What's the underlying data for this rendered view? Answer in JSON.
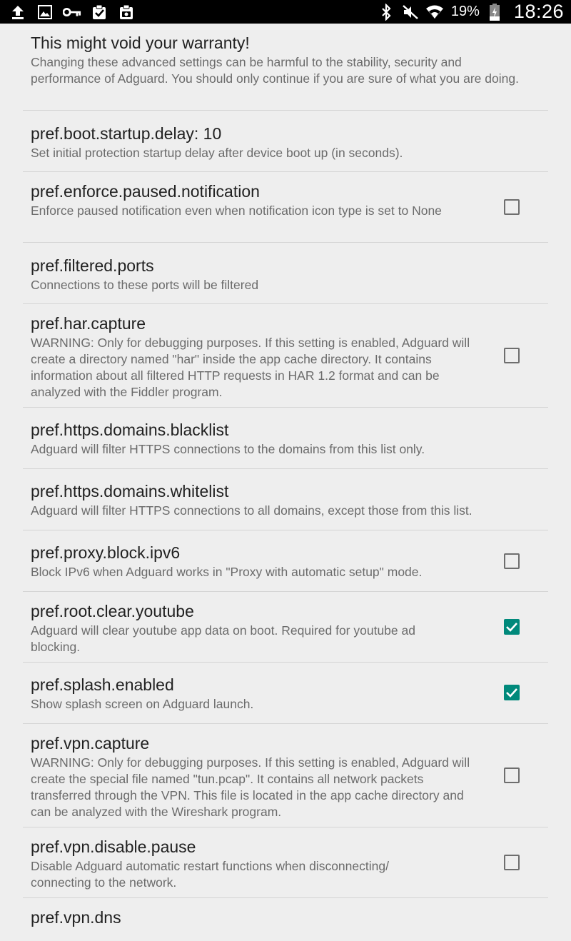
{
  "status_bar": {
    "left_icons": [
      "upload-icon",
      "image-icon",
      "key-icon",
      "clipboard-check-icon",
      "clipboard-camera-icon"
    ],
    "right_icons": [
      "bluetooth-icon",
      "muted-icon",
      "wifi-icon",
      "battery-charging-icon"
    ],
    "battery": "19%",
    "time": "18:26"
  },
  "preferences": [
    {
      "title": "This might void your warranty!",
      "summary": "Changing these advanced settings can be harmful to the stability, security and performance of Adguard. You should only continue if you are sure of what you are doing.",
      "checkbox": null
    },
    {
      "title": "pref.boot.startup.delay: 10",
      "summary": "Set initial protection startup delay after device boot up (in seconds).",
      "checkbox": null
    },
    {
      "title": "pref.enforce.paused.notification",
      "summary": "Enforce paused notification even when notification icon type is set to None",
      "checkbox": false
    },
    {
      "title": "pref.filtered.ports",
      "summary": "Connections to these ports will be filtered",
      "checkbox": null
    },
    {
      "title": "pref.har.capture",
      "summary": "WARNING: Only for debugging purposes. If this setting is enabled, Adguard will create a directory named \"har\" inside the app cache directory. It contains information about all filtered HTTP requests in HAR 1.2 format and can be analyzed with the Fiddler program.",
      "checkbox": false
    },
    {
      "title": "pref.https.domains.blacklist",
      "summary": "Adguard will filter HTTPS connections to the domains from this list only.",
      "checkbox": null
    },
    {
      "title": "pref.https.domains.whitelist",
      "summary": "Adguard will filter HTTPS connections to all domains, except those from this list.",
      "checkbox": null
    },
    {
      "title": "pref.proxy.block.ipv6",
      "summary": "Block IPv6 when Adguard works in \"Proxy with automatic setup\" mode.",
      "checkbox": false
    },
    {
      "title": "pref.root.clear.youtube",
      "summary": "Adguard will clear youtube app data on boot. Required for youtube ad blocking.",
      "checkbox": true
    },
    {
      "title": "pref.splash.enabled",
      "summary": "Show splash screen on Adguard launch.",
      "checkbox": true
    },
    {
      "title": "pref.vpn.capture",
      "summary": "WARNING: Only for debugging purposes. If this setting is enabled, Adguard will create the special file named \"tun.pcap\". It contains all network packets transferred through the VPN. This file is located in the app cache directory and can be analyzed with the Wireshark program.",
      "checkbox": false
    },
    {
      "title": "pref.vpn.disable.pause",
      "summary": "Disable Adguard automatic restart functions when disconnecting/ connecting to the network.",
      "checkbox": false
    },
    {
      "title": "pref.vpn.dns",
      "summary": "",
      "checkbox": null
    }
  ],
  "colors": {
    "accent": "#00897b",
    "background": "#eeeeee",
    "status_bar": "#000000"
  }
}
